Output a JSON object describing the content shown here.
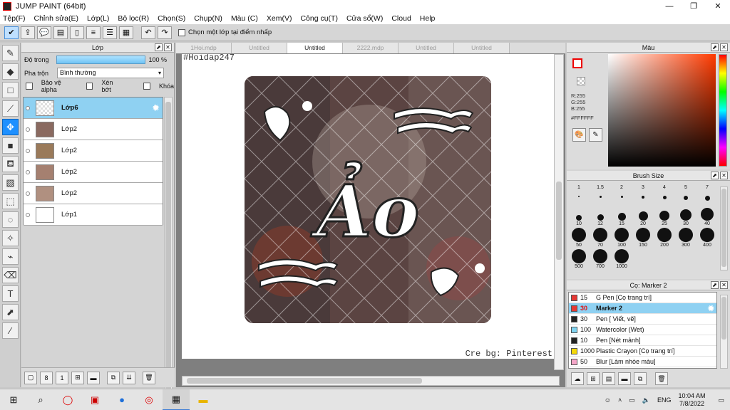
{
  "window": {
    "title": "JUMP PAINT (64bit)",
    "minimize": "—",
    "maximize": "❐",
    "close": "✕"
  },
  "menu": [
    "Tệp(F)",
    "Chỉnh sửa(E)",
    "Lớp(L)",
    "Bộ lọc(R)",
    "Chọn(S)",
    "Chụp(N)",
    "Màu (C)",
    "Xem(V)",
    "Công cụ(T)",
    "Cửa sổ(W)",
    "Cloud",
    "Help"
  ],
  "toolbar": {
    "pick_layer_label": "Chọn một lớp tại điểm nhấp"
  },
  "layer_panel": {
    "title": "Lớp",
    "opacity_label": "Độ trong",
    "opacity_value": "100 %",
    "opacity": 1.0,
    "blend_label": "Pha trộn",
    "blend_value": "Bình thường",
    "protect_alpha": "Bảo vệ alpha",
    "clip": "Xén bớt",
    "lock": "Khóa",
    "layers": [
      {
        "name": "Lớp6",
        "selected": true
      },
      {
        "name": "Lớp2",
        "selected": false
      },
      {
        "name": "Lớp2",
        "selected": false
      },
      {
        "name": "Lớp2",
        "selected": false
      },
      {
        "name": "Lớp2",
        "selected": false
      },
      {
        "name": "Lớp1",
        "selected": false
      }
    ]
  },
  "tabs": [
    "1Hoi.mdp",
    "Untitled",
    "Untitled",
    "2222.mdp",
    "Untitled",
    "Untitled"
  ],
  "active_tab": 2,
  "canvas": {
    "watermark": "#Hoidap247",
    "credit": "Cre bg: Pinterest",
    "art_text": "Ảo"
  },
  "color_panel": {
    "title": "Màu",
    "r": "R:255",
    "g": "G:255",
    "b": "B:255",
    "hex": "#FFFFFF"
  },
  "brush_panel": {
    "title": "Brush Size",
    "sizes": [
      "1",
      "1.5",
      "2",
      "3",
      "4",
      "5",
      "7",
      "10",
      "12",
      "15",
      "20",
      "25",
      "30",
      "40",
      "50",
      "70",
      "100",
      "150",
      "200",
      "300",
      "400",
      "500",
      "700",
      "1000"
    ]
  },
  "tool_panel": {
    "title": "Cọ: Marker 2",
    "items": [
      {
        "size": "15",
        "name": "G Pen [Cọ trang trí]",
        "color": "#e53935",
        "selected": false
      },
      {
        "size": "30",
        "name": "Marker 2",
        "color": "#e53935",
        "selected": true
      },
      {
        "size": "30",
        "name": "Pen [ Viết, vẽ]",
        "color": "#222222",
        "selected": false
      },
      {
        "size": "100",
        "name": "Watercolor (Wet)",
        "color": "#7fd3f0",
        "selected": false
      },
      {
        "size": "10",
        "name": "Pen [Nét mảnh]",
        "color": "#222222",
        "selected": false
      },
      {
        "size": "1000",
        "name": "Plastic Crayon [Cọ trang trí]",
        "color": "#f5d90a",
        "selected": false
      },
      {
        "size": "50",
        "name": "Blur [Làm nhòe màu]",
        "color": "#f4a6c8",
        "selected": false
      }
    ]
  },
  "taskbar": {
    "language": "ENG",
    "time": "10:04 AM",
    "date": "7/8/2022"
  }
}
